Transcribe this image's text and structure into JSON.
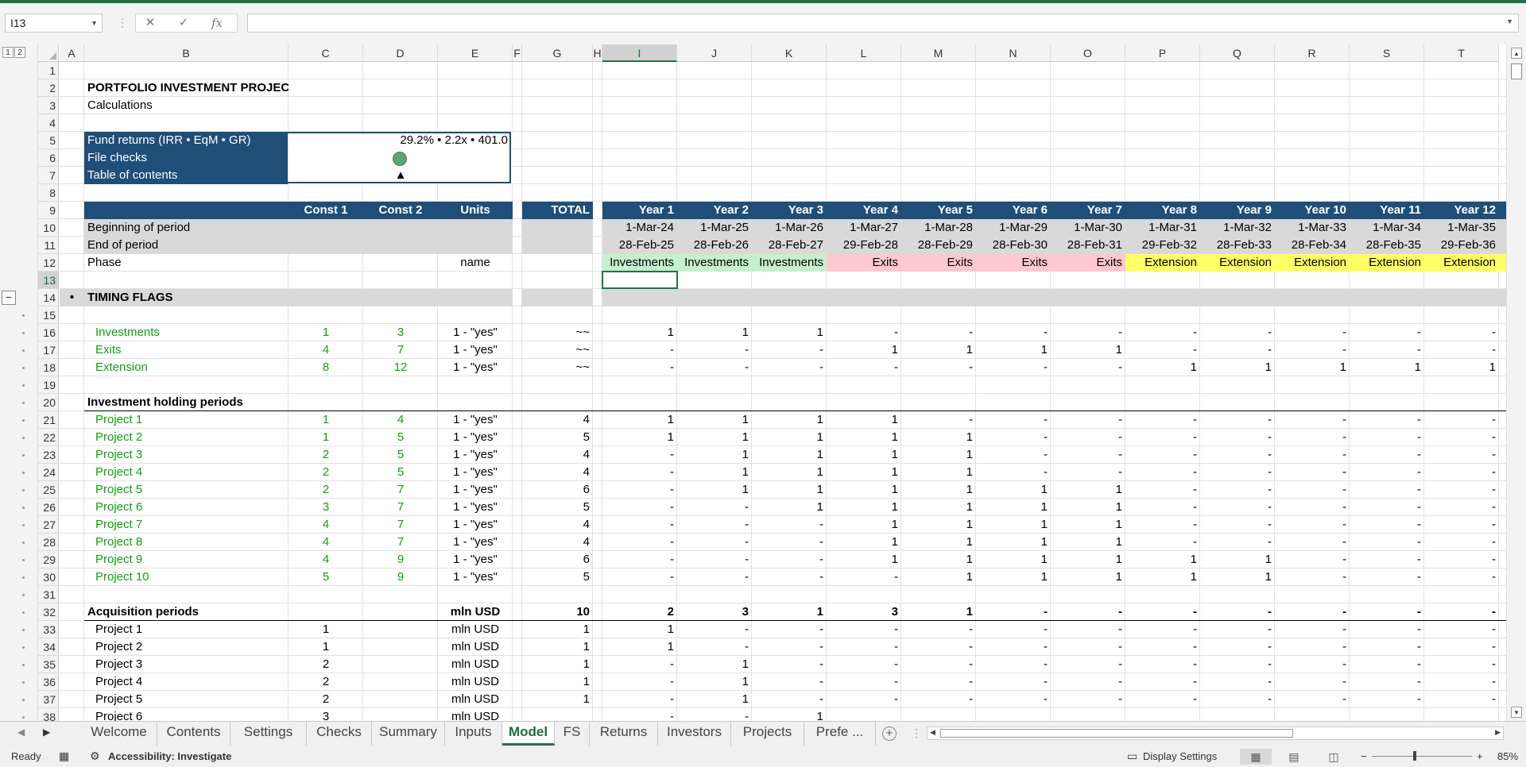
{
  "name_box": "I13",
  "formula_icons": [
    "cancel-icon",
    "enter-icon",
    "function-icon"
  ],
  "columns": [
    {
      "id": "A",
      "label": "A"
    },
    {
      "id": "B",
      "label": "B"
    },
    {
      "id": "C",
      "label": "C"
    },
    {
      "id": "D",
      "label": "D"
    },
    {
      "id": "E",
      "label": "E"
    },
    {
      "id": "F",
      "label": "F"
    },
    {
      "id": "G",
      "label": "G"
    },
    {
      "id": "H",
      "label": "H"
    },
    {
      "id": "I",
      "label": "I"
    },
    {
      "id": "J",
      "label": "J"
    },
    {
      "id": "K",
      "label": "K"
    },
    {
      "id": "L",
      "label": "L"
    },
    {
      "id": "M",
      "label": "M"
    },
    {
      "id": "N",
      "label": "N"
    },
    {
      "id": "O",
      "label": "O"
    },
    {
      "id": "P",
      "label": "P"
    },
    {
      "id": "Q",
      "label": "Q"
    },
    {
      "id": "R",
      "label": "R"
    },
    {
      "id": "S",
      "label": "S"
    },
    {
      "id": "T",
      "label": "T"
    }
  ],
  "rows": [
    1,
    2,
    3,
    4,
    5,
    6,
    7,
    8,
    9,
    10,
    11,
    12,
    13,
    14,
    15,
    16,
    17,
    18,
    19,
    20,
    21,
    22,
    23,
    24,
    25,
    26,
    27,
    28,
    29,
    30,
    31,
    32,
    33,
    34,
    35,
    36,
    37,
    38
  ],
  "outline_levels": [
    "1",
    "2"
  ],
  "selected": {
    "col": "I",
    "row": 13
  },
  "colors": {
    "navy": "#1f4e79",
    "grey": "#d9d9d9",
    "green_text": "#11a011",
    "investments": "#c6efce",
    "exits": "#ffc7ce",
    "extension": "#ffff66",
    "excel_green": "#217346",
    "check_ok": "#5fa37e"
  },
  "sheet": {
    "title": "PORTFOLIO INVESTMENT PROJECTS",
    "subtitle": "Calculations",
    "summary_box": [
      {
        "label": "Fund returns (IRR • EqM • GR)",
        "value": "29.2% • 2.2x • 401.0"
      },
      {
        "label": "File checks",
        "value": ""
      },
      {
        "label": "Table of contents",
        "value": "▲"
      }
    ],
    "header": {
      "const1": "Const 1",
      "const2": "Const 2",
      "units": "Units",
      "total": "TOTAL"
    },
    "years": [
      "Year 1",
      "Year 2",
      "Year 3",
      "Year 4",
      "Year 5",
      "Year 6",
      "Year 7",
      "Year 8",
      "Year 9",
      "Year 10",
      "Year 11",
      "Year 12"
    ],
    "begin_label": "Beginning of period",
    "begin_dates": [
      "1-Mar-24",
      "1-Mar-25",
      "1-Mar-26",
      "1-Mar-27",
      "1-Mar-28",
      "1-Mar-29",
      "1-Mar-30",
      "1-Mar-31",
      "1-Mar-32",
      "1-Mar-33",
      "1-Mar-34",
      "1-Mar-35"
    ],
    "end_label": "End of period",
    "end_dates": [
      "28-Feb-25",
      "28-Feb-26",
      "28-Feb-27",
      "29-Feb-28",
      "28-Feb-29",
      "28-Feb-30",
      "28-Feb-31",
      "29-Feb-32",
      "28-Feb-33",
      "28-Feb-34",
      "28-Feb-35",
      "29-Feb-36"
    ],
    "phase_label": "Phase",
    "phase_units": "name",
    "phases": [
      "Investments",
      "Investments",
      "Investments",
      "Exits",
      "Exits",
      "Exits",
      "Exits",
      "Extension",
      "Extension",
      "Extension",
      "Extension",
      "Extension"
    ],
    "section_bullet": "•",
    "section_title": "TIMING FLAGS",
    "flags": [
      {
        "label": "Investments",
        "c1": "1",
        "c2": "3",
        "units": "1 - \"yes\"",
        "total": "~~",
        "values": [
          "1",
          "1",
          "1",
          "-",
          "-",
          "-",
          "-",
          "-",
          "-",
          "-",
          "-",
          "-"
        ]
      },
      {
        "label": "Exits",
        "c1": "4",
        "c2": "7",
        "units": "1 - \"yes\"",
        "total": "~~",
        "values": [
          "-",
          "-",
          "-",
          "1",
          "1",
          "1",
          "1",
          "-",
          "-",
          "-",
          "-",
          "-"
        ]
      },
      {
        "label": "Extension",
        "c1": "8",
        "c2": "12",
        "units": "1 - \"yes\"",
        "total": "~~",
        "values": [
          "-",
          "-",
          "-",
          "-",
          "-",
          "-",
          "-",
          "1",
          "1",
          "1",
          "1",
          "1"
        ]
      }
    ],
    "holding_title": "Investment holding periods",
    "holding": [
      {
        "label": "Project 1",
        "c1": "1",
        "c2": "4",
        "units": "1 - \"yes\"",
        "total": "4",
        "values": [
          "1",
          "1",
          "1",
          "1",
          "-",
          "-",
          "-",
          "-",
          "-",
          "-",
          "-",
          "-"
        ]
      },
      {
        "label": "Project 2",
        "c1": "1",
        "c2": "5",
        "units": "1 - \"yes\"",
        "total": "5",
        "values": [
          "1",
          "1",
          "1",
          "1",
          "1",
          "-",
          "-",
          "-",
          "-",
          "-",
          "-",
          "-"
        ]
      },
      {
        "label": "Project 3",
        "c1": "2",
        "c2": "5",
        "units": "1 - \"yes\"",
        "total": "4",
        "values": [
          "-",
          "1",
          "1",
          "1",
          "1",
          "-",
          "-",
          "-",
          "-",
          "-",
          "-",
          "-"
        ]
      },
      {
        "label": "Project 4",
        "c1": "2",
        "c2": "5",
        "units": "1 - \"yes\"",
        "total": "4",
        "values": [
          "-",
          "1",
          "1",
          "1",
          "1",
          "-",
          "-",
          "-",
          "-",
          "-",
          "-",
          "-"
        ]
      },
      {
        "label": "Project 5",
        "c1": "2",
        "c2": "7",
        "units": "1 - \"yes\"",
        "total": "6",
        "values": [
          "-",
          "1",
          "1",
          "1",
          "1",
          "1",
          "1",
          "-",
          "-",
          "-",
          "-",
          "-"
        ]
      },
      {
        "label": "Project 6",
        "c1": "3",
        "c2": "7",
        "units": "1 - \"yes\"",
        "total": "5",
        "values": [
          "-",
          "-",
          "1",
          "1",
          "1",
          "1",
          "1",
          "-",
          "-",
          "-",
          "-",
          "-"
        ]
      },
      {
        "label": "Project 7",
        "c1": "4",
        "c2": "7",
        "units": "1 - \"yes\"",
        "total": "4",
        "values": [
          "-",
          "-",
          "-",
          "1",
          "1",
          "1",
          "1",
          "-",
          "-",
          "-",
          "-",
          "-"
        ]
      },
      {
        "label": "Project 8",
        "c1": "4",
        "c2": "7",
        "units": "1 - \"yes\"",
        "total": "4",
        "values": [
          "-",
          "-",
          "-",
          "1",
          "1",
          "1",
          "1",
          "-",
          "-",
          "-",
          "-",
          "-"
        ]
      },
      {
        "label": "Project 9",
        "c1": "4",
        "c2": "9",
        "units": "1 - \"yes\"",
        "total": "6",
        "values": [
          "-",
          "-",
          "-",
          "1",
          "1",
          "1",
          "1",
          "1",
          "1",
          "-",
          "-",
          "-"
        ]
      },
      {
        "label": "Project 10",
        "c1": "5",
        "c2": "9",
        "units": "1 - \"yes\"",
        "total": "5",
        "values": [
          "-",
          "-",
          "-",
          "-",
          "1",
          "1",
          "1",
          "1",
          "1",
          "-",
          "-",
          "-"
        ]
      }
    ],
    "acquisition": {
      "label": "Acquisition periods",
      "units": "mln USD",
      "total": "10",
      "values": [
        "2",
        "3",
        "1",
        "3",
        "1",
        "-",
        "-",
        "-",
        "-",
        "-",
        "-",
        "-"
      ]
    },
    "acq_rows": [
      {
        "label": "Project 1",
        "c1": "1",
        "units": "mln USD",
        "total": "1",
        "values": [
          "1",
          "-",
          "-",
          "-",
          "-",
          "-",
          "-",
          "-",
          "-",
          "-",
          "-",
          "-"
        ]
      },
      {
        "label": "Project 2",
        "c1": "1",
        "units": "mln USD",
        "total": "1",
        "values": [
          "1",
          "-",
          "-",
          "-",
          "-",
          "-",
          "-",
          "-",
          "-",
          "-",
          "-",
          "-"
        ]
      },
      {
        "label": "Project 3",
        "c1": "2",
        "units": "mln USD",
        "total": "1",
        "values": [
          "-",
          "1",
          "-",
          "-",
          "-",
          "-",
          "-",
          "-",
          "-",
          "-",
          "-",
          "-"
        ]
      },
      {
        "label": "Project 4",
        "c1": "2",
        "units": "mln USD",
        "total": "1",
        "values": [
          "-",
          "1",
          "-",
          "-",
          "-",
          "-",
          "-",
          "-",
          "-",
          "-",
          "-",
          "-"
        ]
      },
      {
        "label": "Project 5",
        "c1": "2",
        "units": "mln USD",
        "total": "1",
        "values": [
          "-",
          "1",
          "-",
          "-",
          "-",
          "-",
          "-",
          "-",
          "-",
          "-",
          "-",
          "-"
        ]
      }
    ],
    "partial_row": {
      "label": "Project 6",
      "c1": "3",
      "units": "mln USD",
      "values": [
        "-",
        "-",
        "1"
      ]
    }
  },
  "tabs": [
    "Welcome",
    "Contents",
    "Settings",
    "Checks",
    "Summary",
    "Inputs",
    "Model",
    "FS",
    "Returns",
    "Investors",
    "Projects",
    "Prefe ..."
  ],
  "active_tab": "Model",
  "status": {
    "ready": "Ready",
    "accessibility": "Accessibility: Investigate",
    "display_settings": "Display Settings",
    "zoom": "85%",
    "zoom_minus": "−",
    "zoom_plus": "+"
  }
}
